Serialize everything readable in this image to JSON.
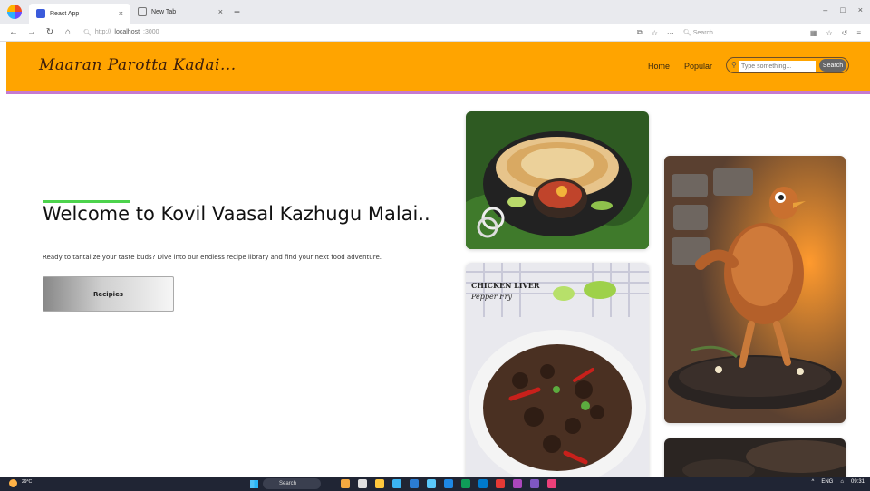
{
  "browser": {
    "tabs": [
      {
        "label": "React App",
        "close": "×"
      },
      {
        "label": "New Tab",
        "close": "×"
      }
    ],
    "new_tab": "+",
    "address": {
      "scheme": "http://",
      "host": "localhost",
      "port": ":3000"
    },
    "search_placeholder": "Search",
    "window_controls": [
      "–",
      "□",
      "×"
    ]
  },
  "header": {
    "brand": "Maaran Parotta Kadai...",
    "nav": {
      "home": "Home",
      "popular": "Popular"
    },
    "search": {
      "placeholder": "Type something...",
      "button": "Search"
    },
    "colors": {
      "background": "#ffa400",
      "border": "#c57ad0"
    }
  },
  "hero": {
    "title": "Welcome to Kovil Vaasal Kazhugu Malai..",
    "subtitle": "Ready to tantalize your taste buds? Dive into our endless recipe library and find your next food adventure.",
    "cta": "Recipies",
    "accent_color": "#4cd34c"
  },
  "gallery": {
    "cards": [
      {
        "subject": "parotta-with-curry"
      },
      {
        "subject": "chicken-liver-pepper-fry",
        "label_line1": "CHICKEN LIVER",
        "label_line2": "Pepper Fry"
      },
      {
        "subject": "dancing-roast-chicken"
      },
      {
        "subject": "dark-smoky-dish"
      }
    ]
  },
  "taskbar": {
    "weather": "29°C",
    "search": "Search",
    "lang": "ENG",
    "time": "09:31"
  }
}
